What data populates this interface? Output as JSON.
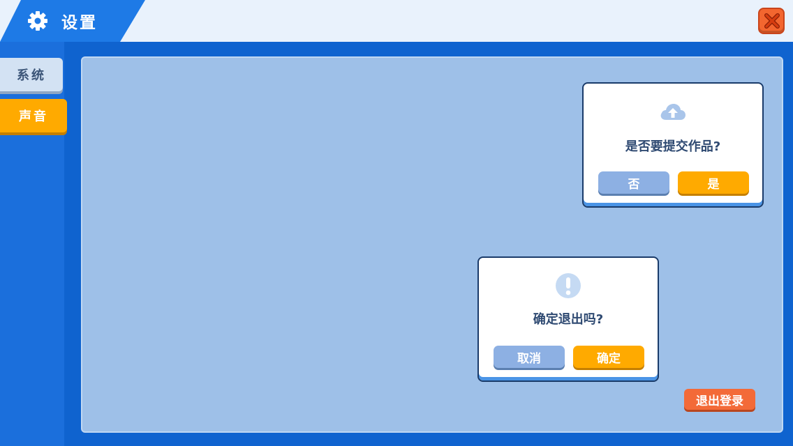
{
  "header": {
    "title": "设置",
    "icon": "gear-icon",
    "close_icon": "close-icon"
  },
  "sidebar": {
    "tabs": [
      {
        "label": "系统",
        "active": false
      },
      {
        "label": "声音",
        "active": true
      }
    ]
  },
  "dialogs": {
    "submit": {
      "icon": "cloud-upload-icon",
      "message": "是否要提交作品?",
      "no_label": "否",
      "yes_label": "是"
    },
    "exit": {
      "icon": "exclamation-icon",
      "message": "确定退出吗?",
      "cancel_label": "取消",
      "confirm_label": "确定"
    }
  },
  "logout": {
    "label": "退出登录"
  },
  "colors": {
    "primary_blue": "#1e7ae6",
    "accent_orange": "#ffaa00",
    "danger_orange": "#f36a38",
    "panel_blue": "#9ec0e8"
  }
}
